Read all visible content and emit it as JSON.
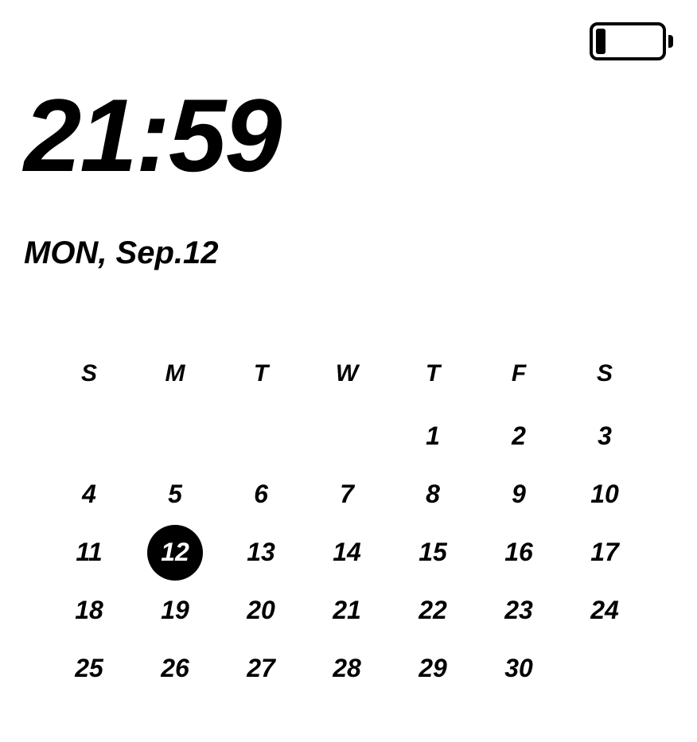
{
  "header": {
    "battery_percent": 12
  },
  "clock": {
    "time": "21:59",
    "date": "MON, Sep.12"
  },
  "calendar": {
    "weekdays": [
      "S",
      "M",
      "T",
      "W",
      "T",
      "F",
      "S"
    ],
    "today": 12,
    "weeks": [
      [
        "",
        "",
        "",
        "",
        "1",
        "2",
        "3"
      ],
      [
        "4",
        "5",
        "6",
        "7",
        "8",
        "9",
        "10"
      ],
      [
        "11",
        "12",
        "13",
        "14",
        "15",
        "16",
        "17"
      ],
      [
        "18",
        "19",
        "20",
        "21",
        "22",
        "23",
        "24"
      ],
      [
        "25",
        "26",
        "27",
        "28",
        "29",
        "30",
        ""
      ]
    ]
  }
}
